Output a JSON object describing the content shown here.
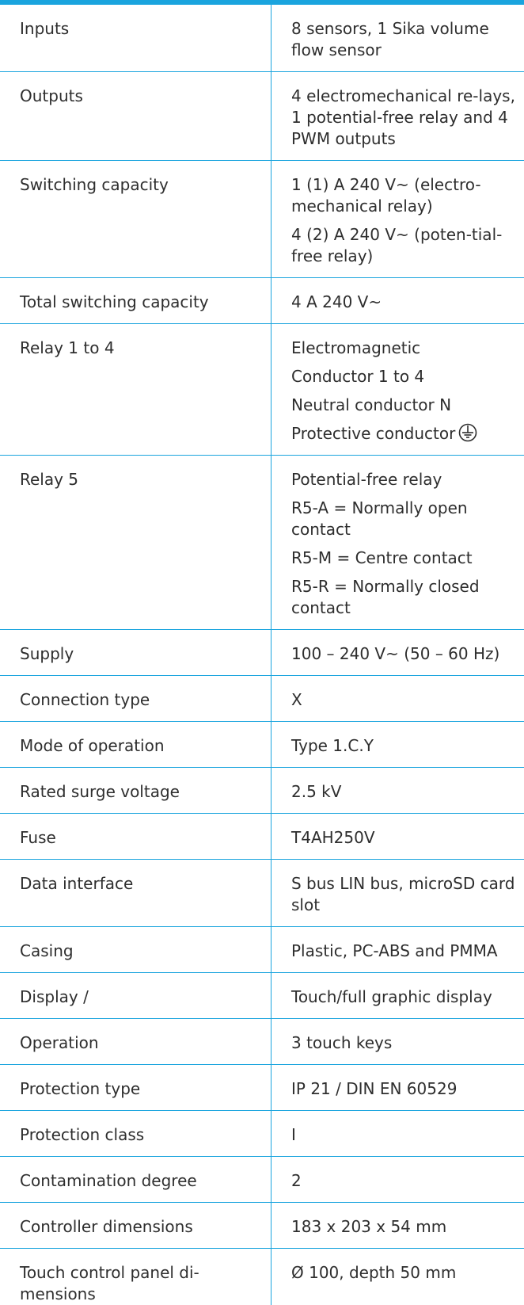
{
  "colors": {
    "accent": "#1aa4de",
    "text": "#2e2e2e"
  },
  "rows": [
    {
      "label": "Inputs",
      "values": [
        "8 sensors, 1 Sika volume flow sensor"
      ]
    },
    {
      "label": "Outputs",
      "values": [
        "4 electromechanical re-lays, 1 potential-free relay and 4 PWM outputs"
      ]
    },
    {
      "label": "Switching capacity",
      "values": [
        "1 (1) A 240 V~ (electro-mechanical relay)",
        "4 (2) A 240 V~ (poten-tial-free relay)"
      ]
    },
    {
      "label": "Total switching capacity",
      "values": [
        "4 A 240 V~"
      ]
    },
    {
      "label": "Relay 1 to 4",
      "values": [
        "Electromagnetic",
        "Conductor 1 to 4",
        "Neutral conductor N",
        "Protective conductor"
      ],
      "icon": "protective-earth-icon"
    },
    {
      "label": "Relay 5",
      "values": [
        "Potential-free relay",
        "R5-A = Normally open contact",
        "R5-M = Centre contact",
        "R5-R = Normally closed contact"
      ]
    },
    {
      "label": "Supply",
      "values": [
        "100 – 240 V~ (50 – 60 Hz)"
      ]
    },
    {
      "label": "Connection type",
      "values": [
        "X"
      ]
    },
    {
      "label": "Mode of operation",
      "values": [
        "Type 1.C.Y"
      ]
    },
    {
      "label": "Rated surge voltage",
      "values": [
        "2.5 kV"
      ]
    },
    {
      "label": "Fuse",
      "values": [
        "T4AH250V"
      ]
    },
    {
      "label": "Data interface",
      "values": [
        "S bus LIN bus, microSD card slot"
      ]
    },
    {
      "label": "Casing",
      "values": [
        "Plastic, PC-ABS and PMMA"
      ]
    },
    {
      "label": "Display /",
      "values": [
        "Touch/full graphic display"
      ]
    },
    {
      "label": "Operation",
      "values": [
        "3 touch keys"
      ]
    },
    {
      "label": "Protection type",
      "values": [
        "IP 21 / DIN EN 60529"
      ]
    },
    {
      "label": "Protection class",
      "values": [
        "I"
      ]
    },
    {
      "label": "Contamination degree",
      "values": [
        "2"
      ]
    },
    {
      "label": "Controller dimensions",
      "values": [
        "183 x 203 x 54 mm"
      ]
    },
    {
      "label": "Touch control panel di-mensions",
      "values": [
        "Ø 100, depth 50 mm"
      ]
    }
  ]
}
